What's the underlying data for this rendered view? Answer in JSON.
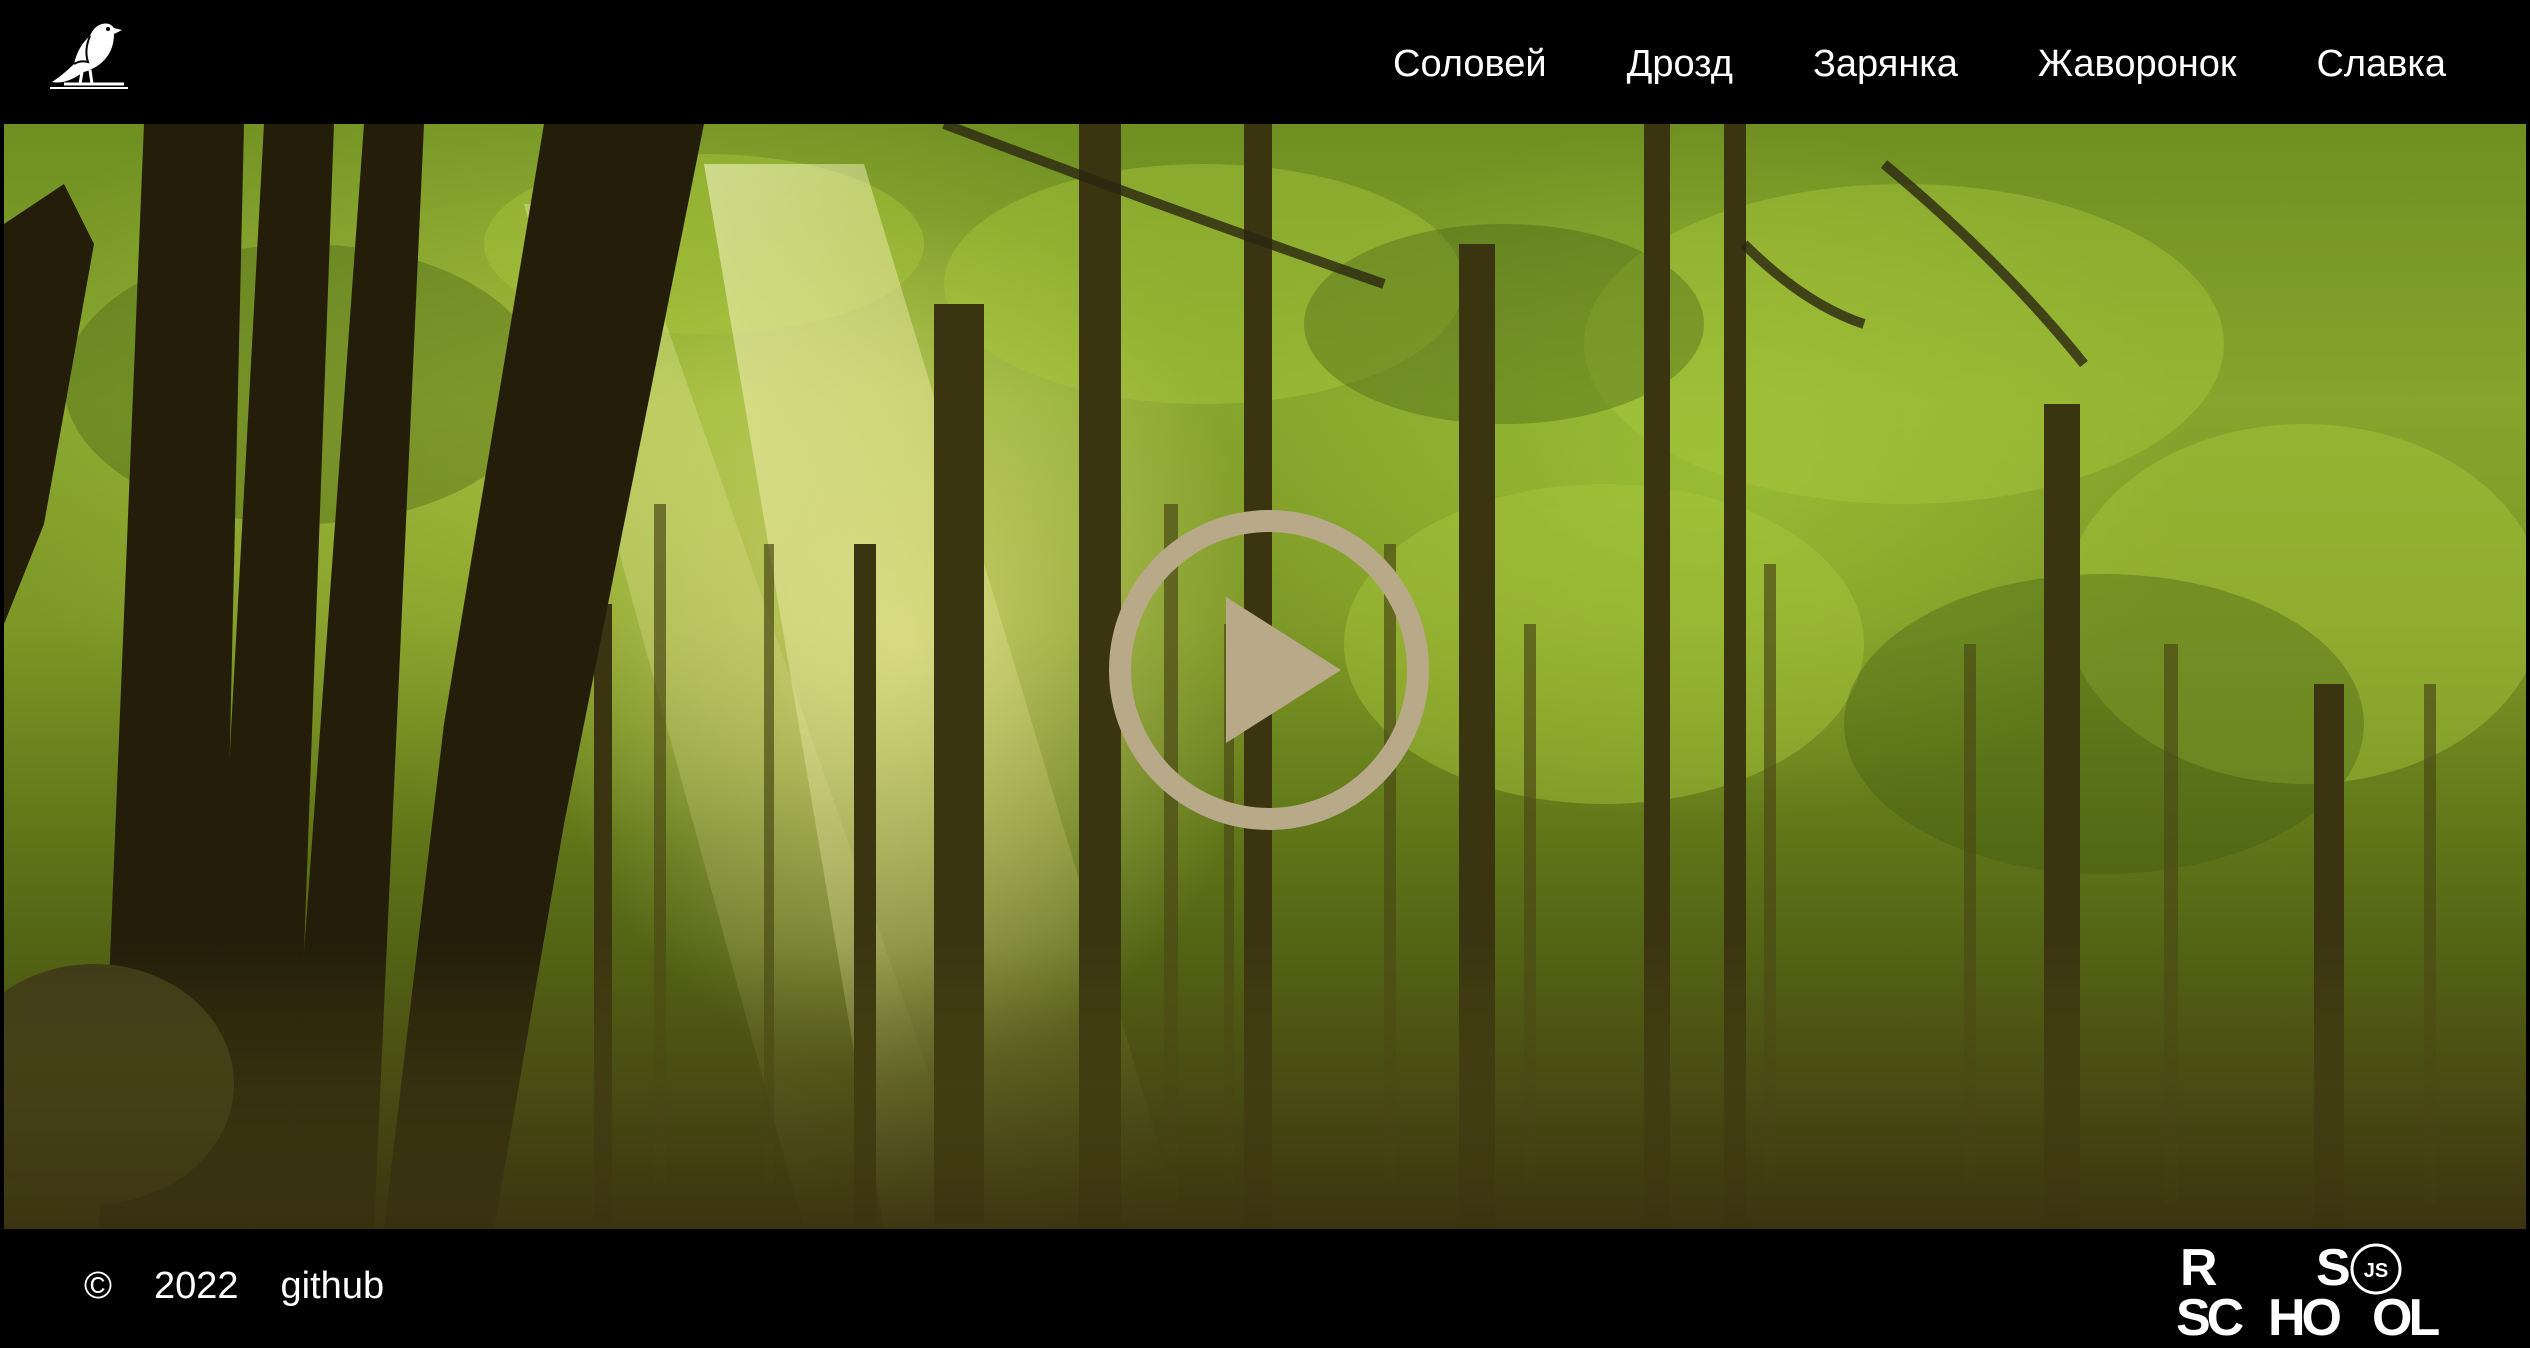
{
  "header": {
    "logo_icon": "bird-icon",
    "nav": [
      {
        "label": "Соловей"
      },
      {
        "label": "Дрозд"
      },
      {
        "label": "Зарянка"
      },
      {
        "label": "Жаворонок"
      },
      {
        "label": "Славка"
      }
    ]
  },
  "hero": {
    "background": "forest-image",
    "play_icon": "play-icon",
    "play_color": "#b8a988"
  },
  "footer": {
    "copyright": "©",
    "year": "2022",
    "github": "github",
    "school_logo": {
      "line1_left": "R",
      "line1_right": "S",
      "line2_left": "SC",
      "line2_mid": "HO",
      "line2_right": "OL",
      "badge": "JS"
    }
  }
}
